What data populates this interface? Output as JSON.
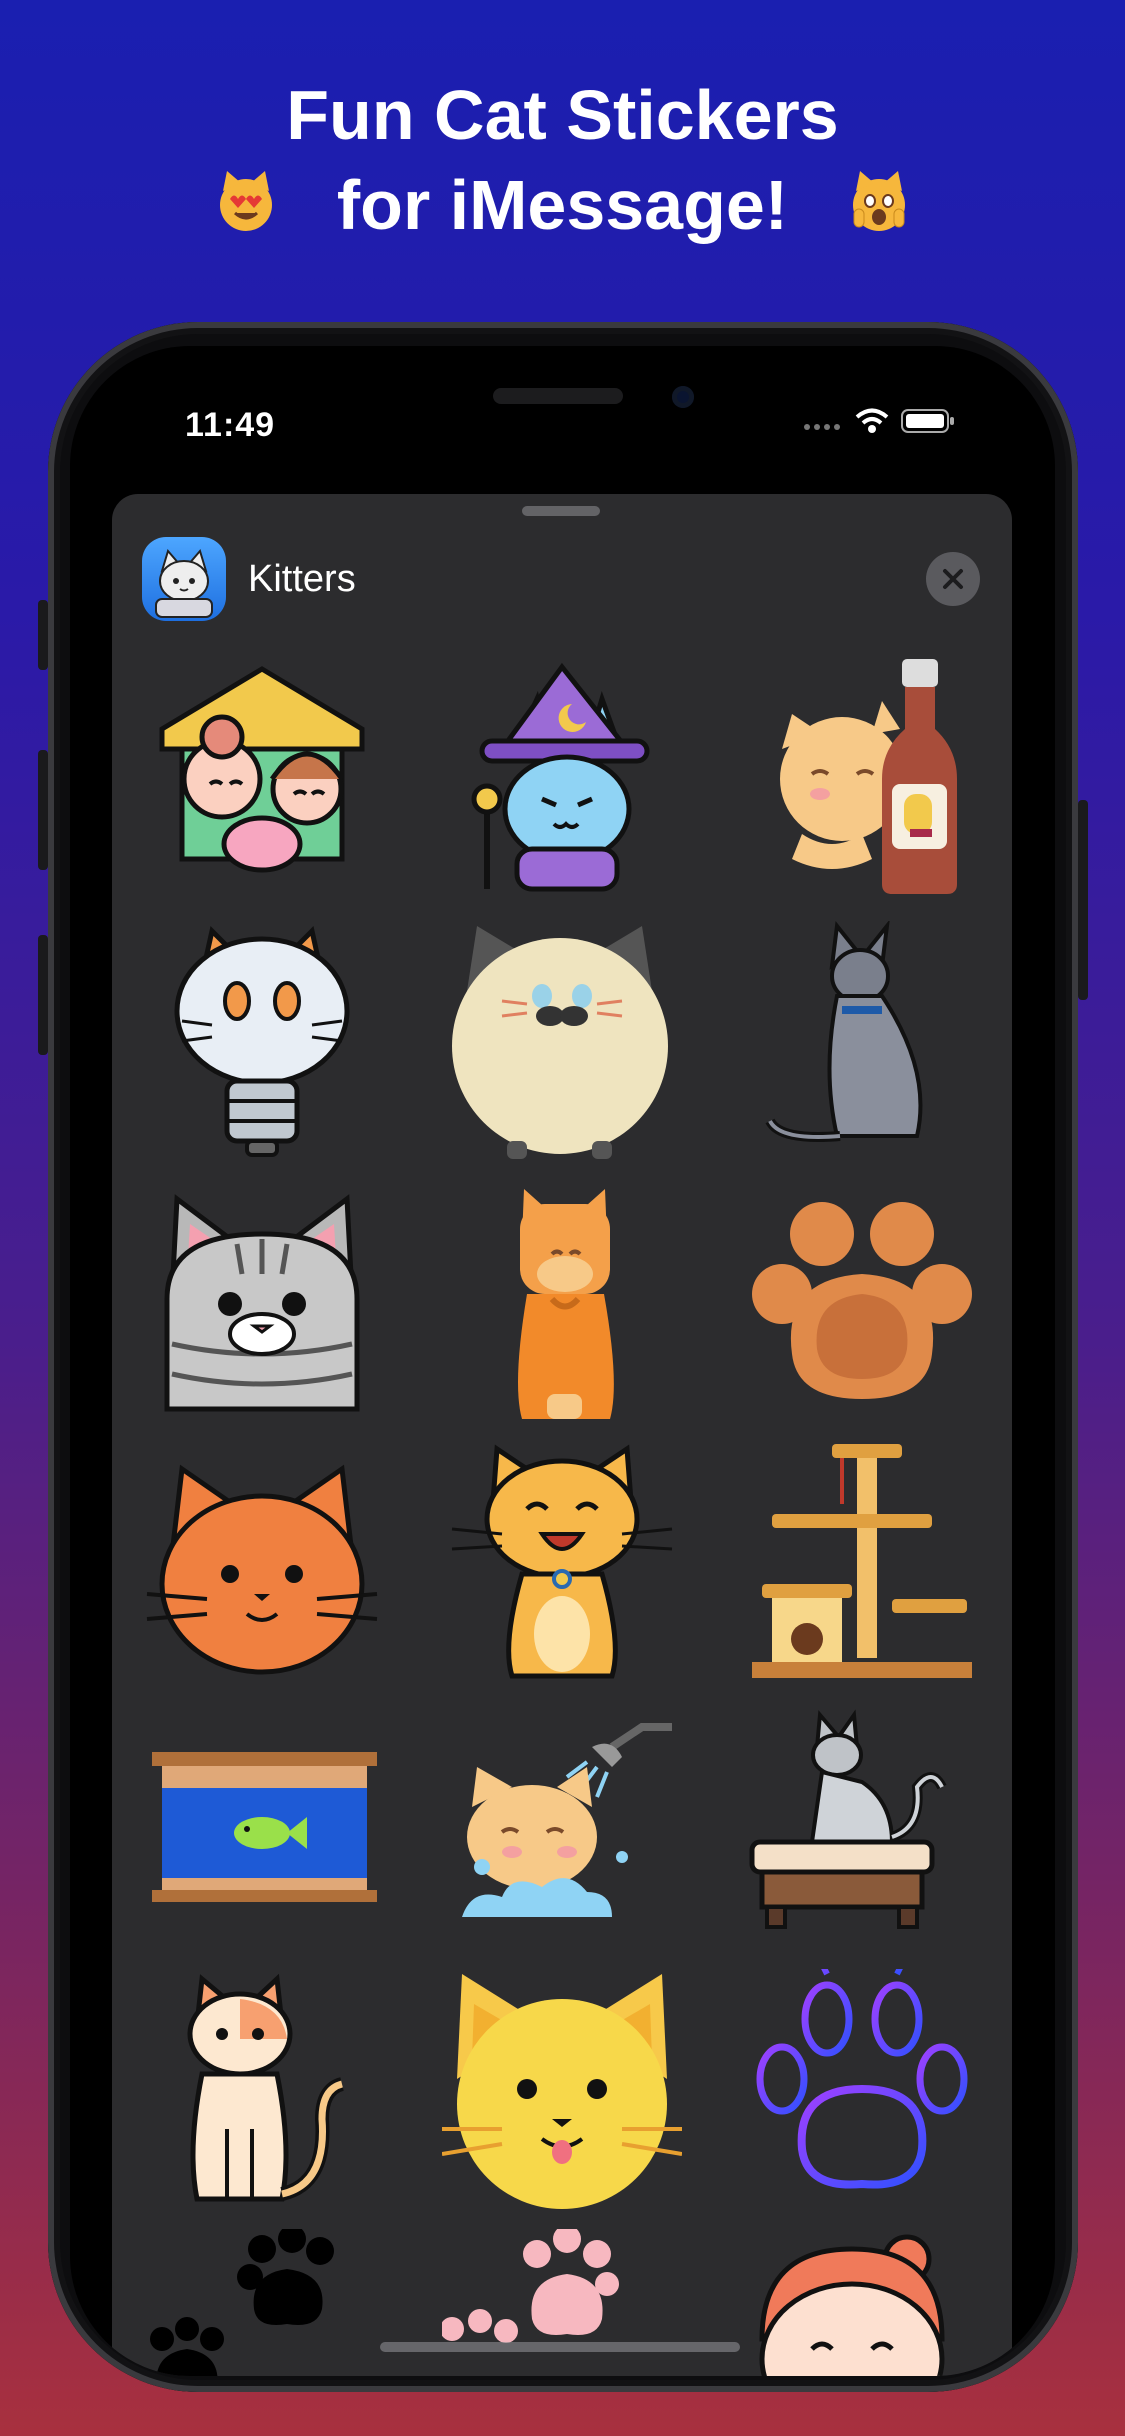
{
  "headline": {
    "line1": "Fun Cat Stickers",
    "line2": "for iMessage!",
    "left_emoji": "heart-eyes-cat-emoji",
    "right_emoji": "weary-cat-emoji"
  },
  "status_bar": {
    "time": "11:49"
  },
  "app": {
    "title": "Kitters",
    "icon": "kitters-app-icon"
  },
  "stickers": [
    {
      "name": "family-house-sticker"
    },
    {
      "name": "wizard-cat-sticker"
    },
    {
      "name": "cat-with-bottle-sticker"
    },
    {
      "name": "cat-lightbulb-sticker"
    },
    {
      "name": "round-fluffy-cat-sticker"
    },
    {
      "name": "sitting-gray-cat-silhouette-sticker"
    },
    {
      "name": "tabby-cat-face-sticker"
    },
    {
      "name": "orange-sitting-cat-sticker"
    },
    {
      "name": "orange-paw-sticker"
    },
    {
      "name": "orange-cat-face-sticker"
    },
    {
      "name": "happy-yellow-cat-sticker"
    },
    {
      "name": "cat-tree-sticker"
    },
    {
      "name": "fish-aquarium-sticker"
    },
    {
      "name": "cat-shower-sticker"
    },
    {
      "name": "cat-on-stool-sticker"
    },
    {
      "name": "calico-sitting-cat-sticker"
    },
    {
      "name": "yellow-cat-face-sticker"
    },
    {
      "name": "neon-paw-sticker"
    },
    {
      "name": "black-paws-sticker"
    },
    {
      "name": "pink-paws-sticker"
    },
    {
      "name": "girl-with-cat-sticker"
    }
  ],
  "colors": {
    "sheet_bg": "#2c2c2e",
    "accent_orange": "#f08a3c",
    "accent_yellow": "#f7c94a"
  }
}
